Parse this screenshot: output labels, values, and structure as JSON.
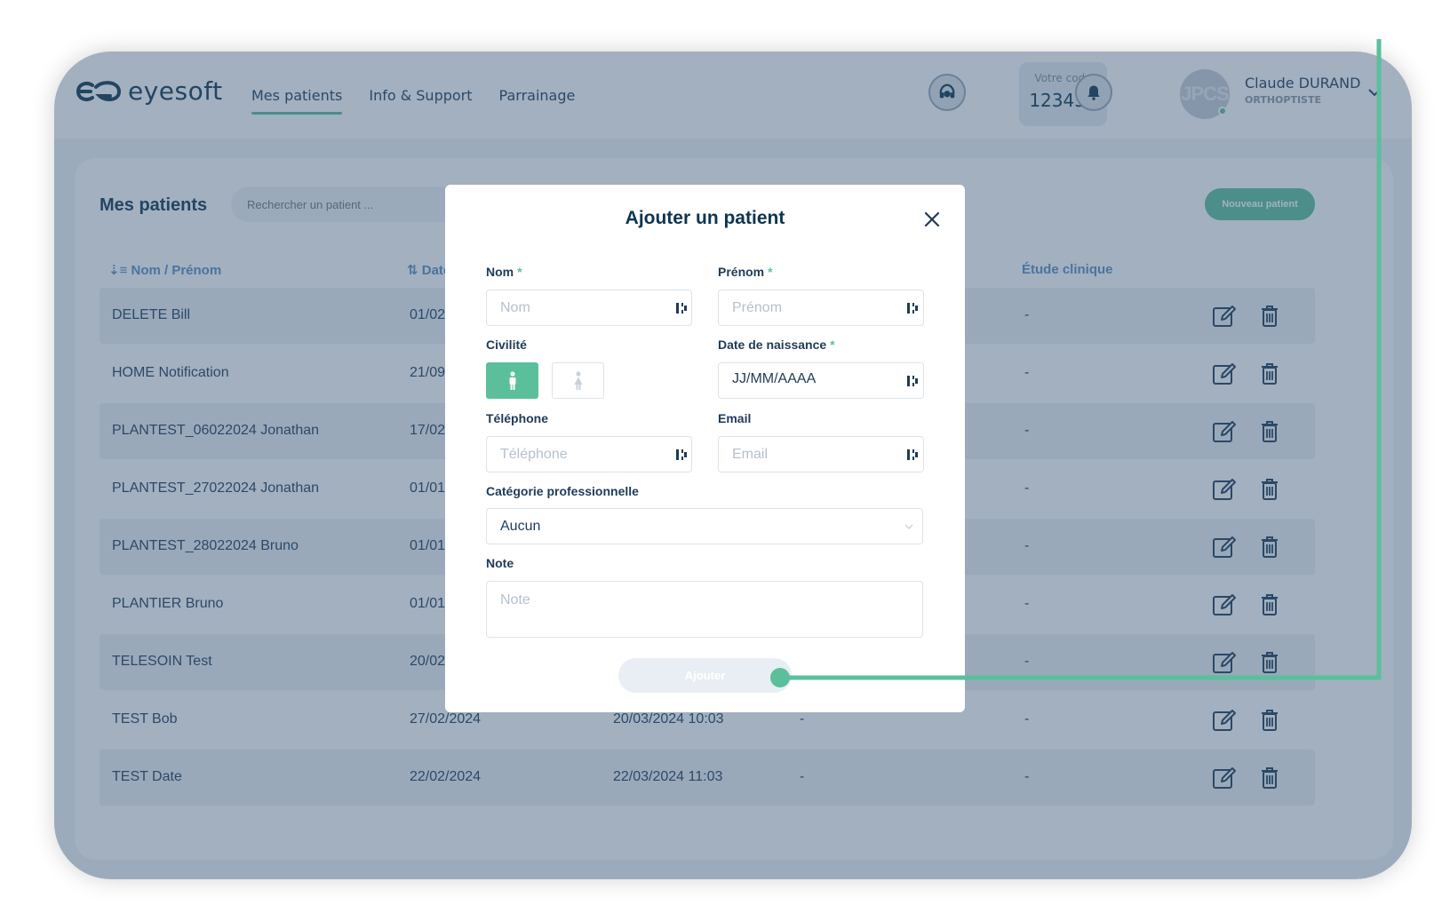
{
  "app": {
    "logo_text": "eyesoft",
    "nav": [
      {
        "label": "Mes patients",
        "active": true
      },
      {
        "label": "Info & Support",
        "active": false
      },
      {
        "label": "Parrainage",
        "active": false
      }
    ],
    "code_label": "Votre code",
    "code_value": "123456",
    "avatar_initials": "JPCS",
    "user_name": "Claude DURAND",
    "user_role": "ORTHOPTISTE"
  },
  "patients": {
    "title": "Mes patients",
    "search_placeholder": "Rechercher un patient ...",
    "new_button": "Nouveau patient",
    "columns": {
      "name": "Nom / Prénom",
      "birth": "Date",
      "study": "Étude clinique"
    },
    "rows": [
      {
        "name": "DELETE Bill",
        "birth": "01/02/",
        "created": "",
        "c4": "",
        "study": "-"
      },
      {
        "name": "HOME Notification",
        "birth": "21/09/",
        "created": "",
        "c4": "",
        "study": "-"
      },
      {
        "name": "PLANTEST_06022024 Jonathan",
        "birth": "17/02/",
        "created": "",
        "c4": "",
        "study": "-"
      },
      {
        "name": "PLANTEST_27022024 Jonathan",
        "birth": "01/01/",
        "created": "",
        "c4": "",
        "study": "-"
      },
      {
        "name": "PLANTEST_28022024 Bruno",
        "birth": "01/01/",
        "created": "",
        "c4": "",
        "study": "-"
      },
      {
        "name": "PLANTIER Bruno",
        "birth": "01/01/",
        "created": "",
        "c4": "",
        "study": "-"
      },
      {
        "name": "TELESOIN Test",
        "birth": "20/02/",
        "created": "",
        "c4": "",
        "study": "-"
      },
      {
        "name": "TEST Bob",
        "birth": "27/02/2024",
        "created": "20/03/2024 10:03",
        "c4": "-",
        "study": "-"
      },
      {
        "name": "TEST Date",
        "birth": "22/02/2024",
        "created": "22/03/2024 11:03",
        "c4": "-",
        "study": "-"
      }
    ]
  },
  "modal": {
    "title": "Ajouter un patient",
    "nom_label": "Nom",
    "nom_placeholder": "Nom",
    "prenom_label": "Prénom",
    "prenom_placeholder": "Prénom",
    "required_mark": "*",
    "civilite_label": "Civilité",
    "dob_label": "Date de naissance",
    "dob_value": "JJ/MM/AAAA",
    "tel_label": "Téléphone",
    "tel_placeholder": "Téléphone",
    "email_label": "Email",
    "email_placeholder": "Email",
    "cat_label": "Catégorie professionnelle",
    "cat_value": "Aucun",
    "note_label": "Note",
    "note_placeholder": "Note",
    "submit_label": "Ajouter"
  },
  "colors": {
    "accent": "#5bbf9b",
    "navy": "#0e3550",
    "overlay": "rgba(57,87,118,0.47)"
  }
}
